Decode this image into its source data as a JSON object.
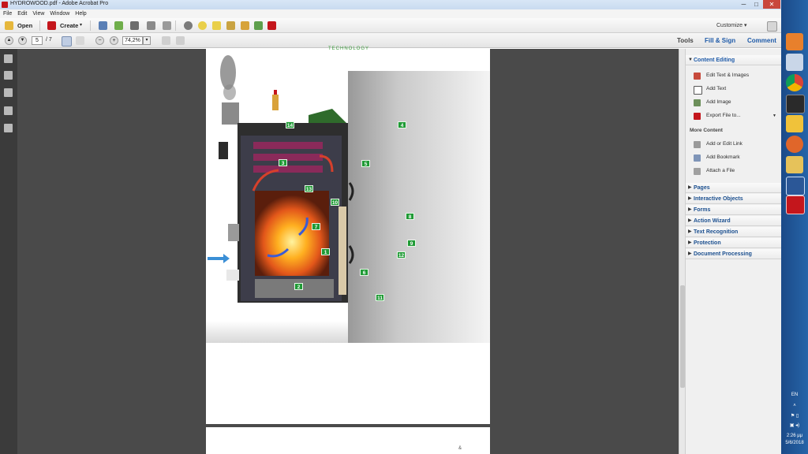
{
  "window": {
    "title": "HYDROWOOD.pdf - Adobe Acrobat Pro",
    "min": "─",
    "max": "□",
    "close": "✕"
  },
  "menu": [
    "File",
    "Edit",
    "View",
    "Window",
    "Help"
  ],
  "toolbar": {
    "open_label": "Open",
    "create_label": "Create",
    "create_arrow": "▾",
    "customize_label": "Customize ▾"
  },
  "navigation": {
    "current_page": "5",
    "total_pages": "/ 7",
    "zoom": "74,2%",
    "zoom_arrow": "▾",
    "zoom_out": "−",
    "zoom_in": "+"
  },
  "tabs": {
    "tools": "Tools",
    "fill_sign": "Fill & Sign",
    "comment": "Comment"
  },
  "document": {
    "header_text": "TECHNOLOGY",
    "page_footer_mark": "&",
    "markers": [
      "14",
      "4",
      "3",
      "5",
      "13",
      "10",
      "8",
      "7",
      "9",
      "1",
      "12",
      "6",
      "2",
      "11"
    ]
  },
  "panel": {
    "content_editing": {
      "title": "Content Editing",
      "arrow": "▼",
      "items": [
        "Edit Text & Images",
        "Add Text",
        "Add Image",
        "Export File to..."
      ]
    },
    "more_content": {
      "title": "More Content",
      "items": [
        "Add or Edit Link",
        "Add Bookmark",
        "Attach a File"
      ]
    },
    "sections": [
      "Pages",
      "Interactive Objects",
      "Forms",
      "Action Wizard",
      "Text Recognition",
      "Protection",
      "Document Processing"
    ],
    "collapsed_arrow": "▶"
  },
  "system_tray": {
    "lang": "EN",
    "time": "2:26 μμ",
    "date": "5/6/2018"
  },
  "colors": {
    "accent": "#1e5aa8",
    "marker_green": "#1f9a35",
    "taskbar": "#1b4a88",
    "close_red": "#c9463d"
  }
}
